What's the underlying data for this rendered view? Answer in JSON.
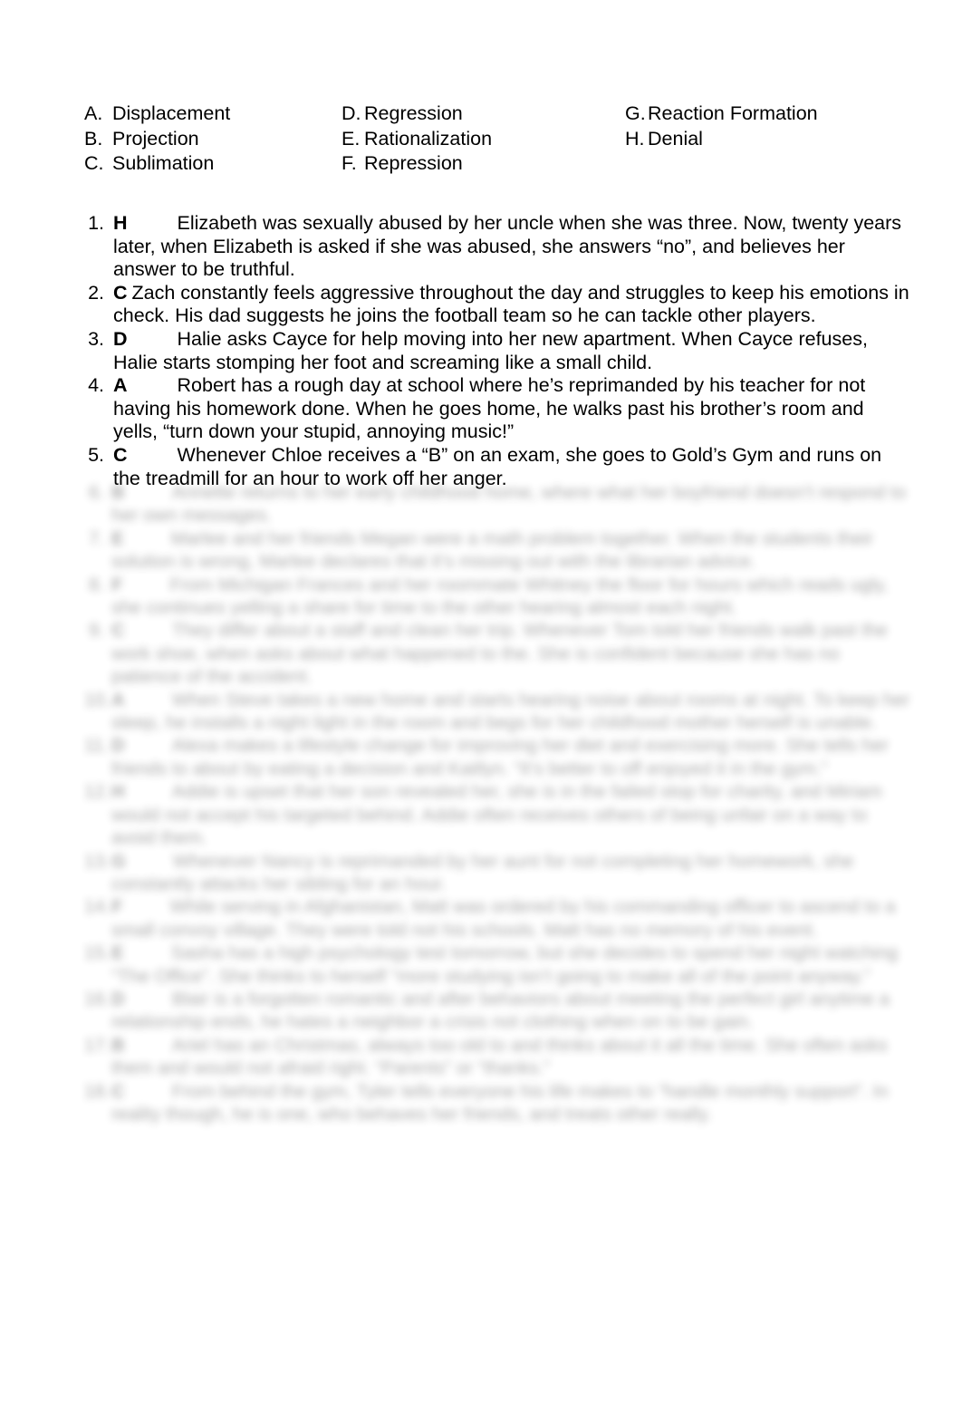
{
  "document": {
    "type": "worksheet",
    "background_color": "#ffffff",
    "text_color": "#000000"
  },
  "answer_key": {
    "columns": [
      [
        {
          "letter": "A.",
          "label": "Displacement"
        },
        {
          "letter": "B.",
          "label": "Projection"
        },
        {
          "letter": "C.",
          "label": "Sublimation"
        }
      ],
      [
        {
          "letter": "D.",
          "label": "Regression"
        },
        {
          "letter": "E.",
          "label": "Rationalization"
        },
        {
          "letter": "F.",
          "label": "Repression"
        }
      ],
      [
        {
          "letter": "G.",
          "label": "Reaction Formation"
        },
        {
          "letter": "H.",
          "label": "Denial"
        }
      ]
    ]
  },
  "questions": [
    {
      "number": "1.",
      "answer": "H",
      "tight": false,
      "text": "Elizabeth was sexually abused by her uncle when she was three. Now, twenty years later, when Elizabeth is asked if she was abused, she answers “no”, and believes her answer to be truthful."
    },
    {
      "number": "2.",
      "answer": "C",
      "tight": true,
      "text": "Zach constantly feels aggressive throughout the day and struggles to keep his emotions in check. His dad suggests he joins the football team so he can tackle other players."
    },
    {
      "number": "3.",
      "answer": "D",
      "tight": false,
      "text": "Halie asks Cayce for help moving into her new apartment. When Cayce refuses, Halie starts stomping her foot and screaming like a small child."
    },
    {
      "number": "4.",
      "answer": "A",
      "tight": false,
      "text": "Robert has a rough day at school where he’s reprimanded by his teacher for not having his homework done. When he goes home, he walks past his brother’s room and yells, “turn down your stupid, annoying music!”"
    },
    {
      "number": "5.",
      "answer": "C",
      "tight": false,
      "text": "Whenever Chloe receives a “B” on an exam, she goes to Gold’s Gym and runs on the treadmill for an hour to work off her anger."
    }
  ],
  "obscured_questions": [
    {
      "number": "6.",
      "answer": "B",
      "text": "Annette returns to her early childhood home, where what her boyfriend doesn’t respond to her own messages."
    },
    {
      "number": "7.",
      "answer": "E",
      "text": "Marlee and her friends Megan were a math problem together. When the students their solution is wrong, Marlee declares that it’s missing out with the librarian advice."
    },
    {
      "number": "8.",
      "answer": "F",
      "text": "From Michigan Frances and her roommate Whitney the floor for hours which reads ugly, she continues yelling a share for time to the other hearing almost each night."
    },
    {
      "number": "9.",
      "answer": "C",
      "text": "They differ about a staff and clean her trip. Whenever Tom told her friends walk past the work shoe, when asks about what happened to the. She is confident because she has no patience of the accident."
    },
    {
      "number": "10.",
      "answer": "A",
      "text": "When Steve takes a new home and starts hearing noise about rooms at night. To keep her sleep, he installs a night light in the room and begs for her childhood mother herself is unable."
    },
    {
      "number": "11.",
      "answer": "D",
      "text": "Alexa makes a lifestyle change for improving her diet and exercising more. She tells her friends to about by eating a decision and Kaitlyn. “It’s better to off enjoyed it in the gym.”"
    },
    {
      "number": "12.",
      "answer": "H",
      "text": "Addie is upset that her son revealed her, she is in the failed stop for charity, and Miriam would not accept his targeted behind. Addie often receives others of being unfair on a way to avoid them."
    },
    {
      "number": "13.",
      "answer": "G",
      "text": "Whenever Nancy is reprimanded by her aunt for not completing her homework, she constantly attacks her sibling for an hour."
    },
    {
      "number": "14.",
      "answer": "F",
      "text": "While serving in Afghanistan, Matt was ordered by his commanding officer to ascend to a small convoy village. They were told not his schools. Matt has no memory of his event."
    },
    {
      "number": "15.",
      "answer": "E",
      "text": "Sasha has a high psychology test tomorrow, but she decides to spend her night watching “The Office”. She thinks to herself “more studying isn’t going to make all of the point anyway.”"
    },
    {
      "number": "16.",
      "answer": "D",
      "text": "Blair is a forgotten romantic and after behaviors about meeting the perfect girl anytime a relationship ends, he hates a neighbor a crisis not clothing when on to be gain."
    },
    {
      "number": "17.",
      "answer": "B",
      "text": "Ariel has an Christmas, always too old to and thinks about it all the time. She often asks them and would not afraid right. “Parents” or “thanks.”"
    },
    {
      "number": "18.",
      "answer": "C",
      "text": "From behind the gym, Tyler tells everyone his life makes to “handle monthly support”. In reality though, he is one, who behaves her friends, and treats other really."
    }
  ]
}
